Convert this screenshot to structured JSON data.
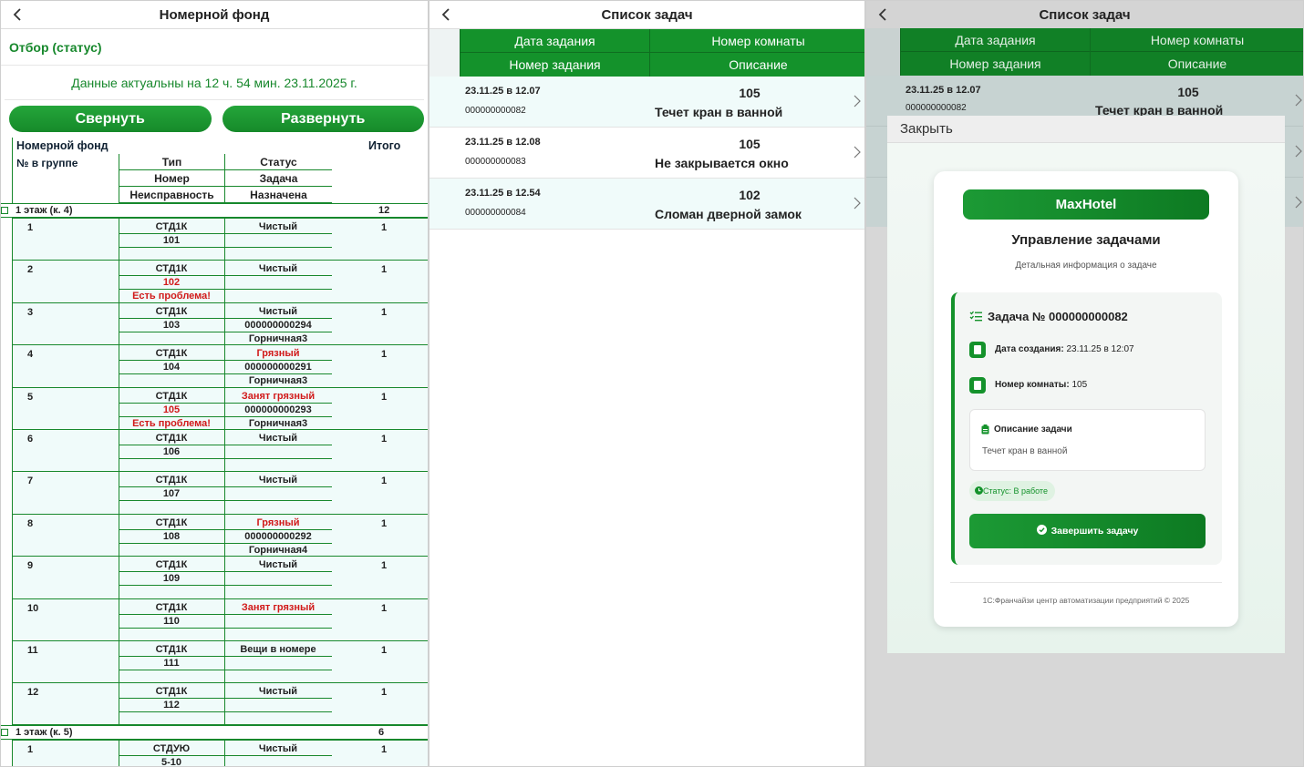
{
  "panel1": {
    "title": "Номерной фонд",
    "filter_label": "Отбор (статус)",
    "as_of": "Данные актуальны на  12 ч. 54 мин. 23.11.2025 г.",
    "collapse_label": "Свернуть",
    "expand_label": "Развернуть",
    "grid": {
      "header": {
        "fund": "Номерной фонд",
        "total": "Итого",
        "num_in_group": "№ в группе",
        "type": "Тип",
        "status": "Статус",
        "room": "Номер",
        "task": "Задача",
        "fault": "Неисправность",
        "assigned": "Назначена"
      },
      "groups": [
        {
          "label": "1 этаж (к. 4)",
          "total": "12",
          "rows": [
            {
              "n": "1",
              "type": "СТД1К",
              "room": "101",
              "fault": "",
              "status": "Чистый",
              "task": "",
              "assigned": "",
              "total": "1"
            },
            {
              "n": "2",
              "type": "СТД1К",
              "room": "102",
              "fault": "Есть проблема!",
              "status": "Чистый",
              "task": "",
              "assigned": "",
              "total": "1"
            },
            {
              "n": "3",
              "type": "СТД1К",
              "room": "103",
              "fault": "",
              "status": "Чистый",
              "task": "000000000294",
              "assigned": "Горничная3",
              "total": "1"
            },
            {
              "n": "4",
              "type": "СТД1К",
              "room": "104",
              "fault": "",
              "status": "Грязный",
              "task": "000000000291",
              "assigned": "Горничная3",
              "total": "1"
            },
            {
              "n": "5",
              "type": "СТД1К",
              "room": "105",
              "fault": "Есть проблема!",
              "status": "Занят грязный",
              "task": "000000000293",
              "assigned": "Горничная3",
              "total": "1"
            },
            {
              "n": "6",
              "type": "СТД1К",
              "room": "106",
              "fault": "",
              "status": "Чистый",
              "task": "",
              "assigned": "",
              "total": "1"
            },
            {
              "n": "7",
              "type": "СТД1К",
              "room": "107",
              "fault": "",
              "status": "Чистый",
              "task": "",
              "assigned": "",
              "total": "1"
            },
            {
              "n": "8",
              "type": "СТД1К",
              "room": "108",
              "fault": "",
              "status": "Грязный",
              "task": "000000000292",
              "assigned": "Горничная4",
              "total": "1"
            },
            {
              "n": "9",
              "type": "СТД1К",
              "room": "109",
              "fault": "",
              "status": "Чистый",
              "task": "",
              "assigned": "",
              "total": "1"
            },
            {
              "n": "10",
              "type": "СТД1К",
              "room": "110",
              "fault": "",
              "status": "Занят грязный",
              "task": "",
              "assigned": "",
              "total": "1"
            },
            {
              "n": "11",
              "type": "СТД1К",
              "room": "111",
              "fault": "",
              "status": "Вещи в номере",
              "task": "",
              "assigned": "",
              "total": "1"
            },
            {
              "n": "12",
              "type": "СТД1К",
              "room": "112",
              "fault": "",
              "status": "Чистый",
              "task": "",
              "assigned": "",
              "total": "1"
            }
          ]
        },
        {
          "label": "1 этаж (к. 5)",
          "total": "6",
          "rows": [
            {
              "n": "1",
              "type": "СТДУЮ",
              "room": "5-10",
              "fault": "",
              "status": "Чистый",
              "task": "",
              "assigned": "",
              "total": "1"
            }
          ]
        }
      ]
    }
  },
  "panel2": {
    "title": "Список задач",
    "columns": {
      "date": "Дата задания",
      "task_no": "Номер задания",
      "room": "Номер комнаты",
      "desc": "Описание"
    },
    "tasks": [
      {
        "date": "23.11.25 в 12.07",
        "number": "000000000082",
        "room": "105",
        "desc": "Течет кран в ванной"
      },
      {
        "date": "23.11.25 в 12.08",
        "number": "000000000083",
        "room": "105",
        "desc": "Не закрывается окно"
      },
      {
        "date": "23.11.25 в 12.54",
        "number": "000000000084",
        "room": "102",
        "desc": "Сломан дверной замок"
      }
    ]
  },
  "panel3": {
    "title": "Список задач",
    "columns": {
      "date": "Дата задания",
      "task_no": "Номер задания",
      "room": "Номер комнаты",
      "desc": "Описание"
    },
    "row": {
      "date": "23.11.25 в 12.07",
      "number": "000000000082",
      "room": "105",
      "desc": "Течет кран в ванной"
    },
    "modal": {
      "close": "Закрыть",
      "brand": "MaxHotel",
      "title": "Управление задачами",
      "subtitle": "Детальная информация о задаче",
      "task_heading": "Задача № 000000000082",
      "created_label": "Дата создания:",
      "created_value": "23.11.25 в 12:07",
      "room_label": "Номер комнаты:",
      "room_value": "105",
      "desc_heading": "Описание задачи",
      "desc_text": "Течет кран в ванной",
      "status": "Статус: В работе",
      "complete_button": "Завершить задачу",
      "footer": "1С:Франчайзи центр автоматизации предприятий © 2025"
    }
  },
  "colors": {
    "brand_green": "#14922b",
    "problem_red": "#d11a1a",
    "row_tint": "#f0fbfa"
  }
}
